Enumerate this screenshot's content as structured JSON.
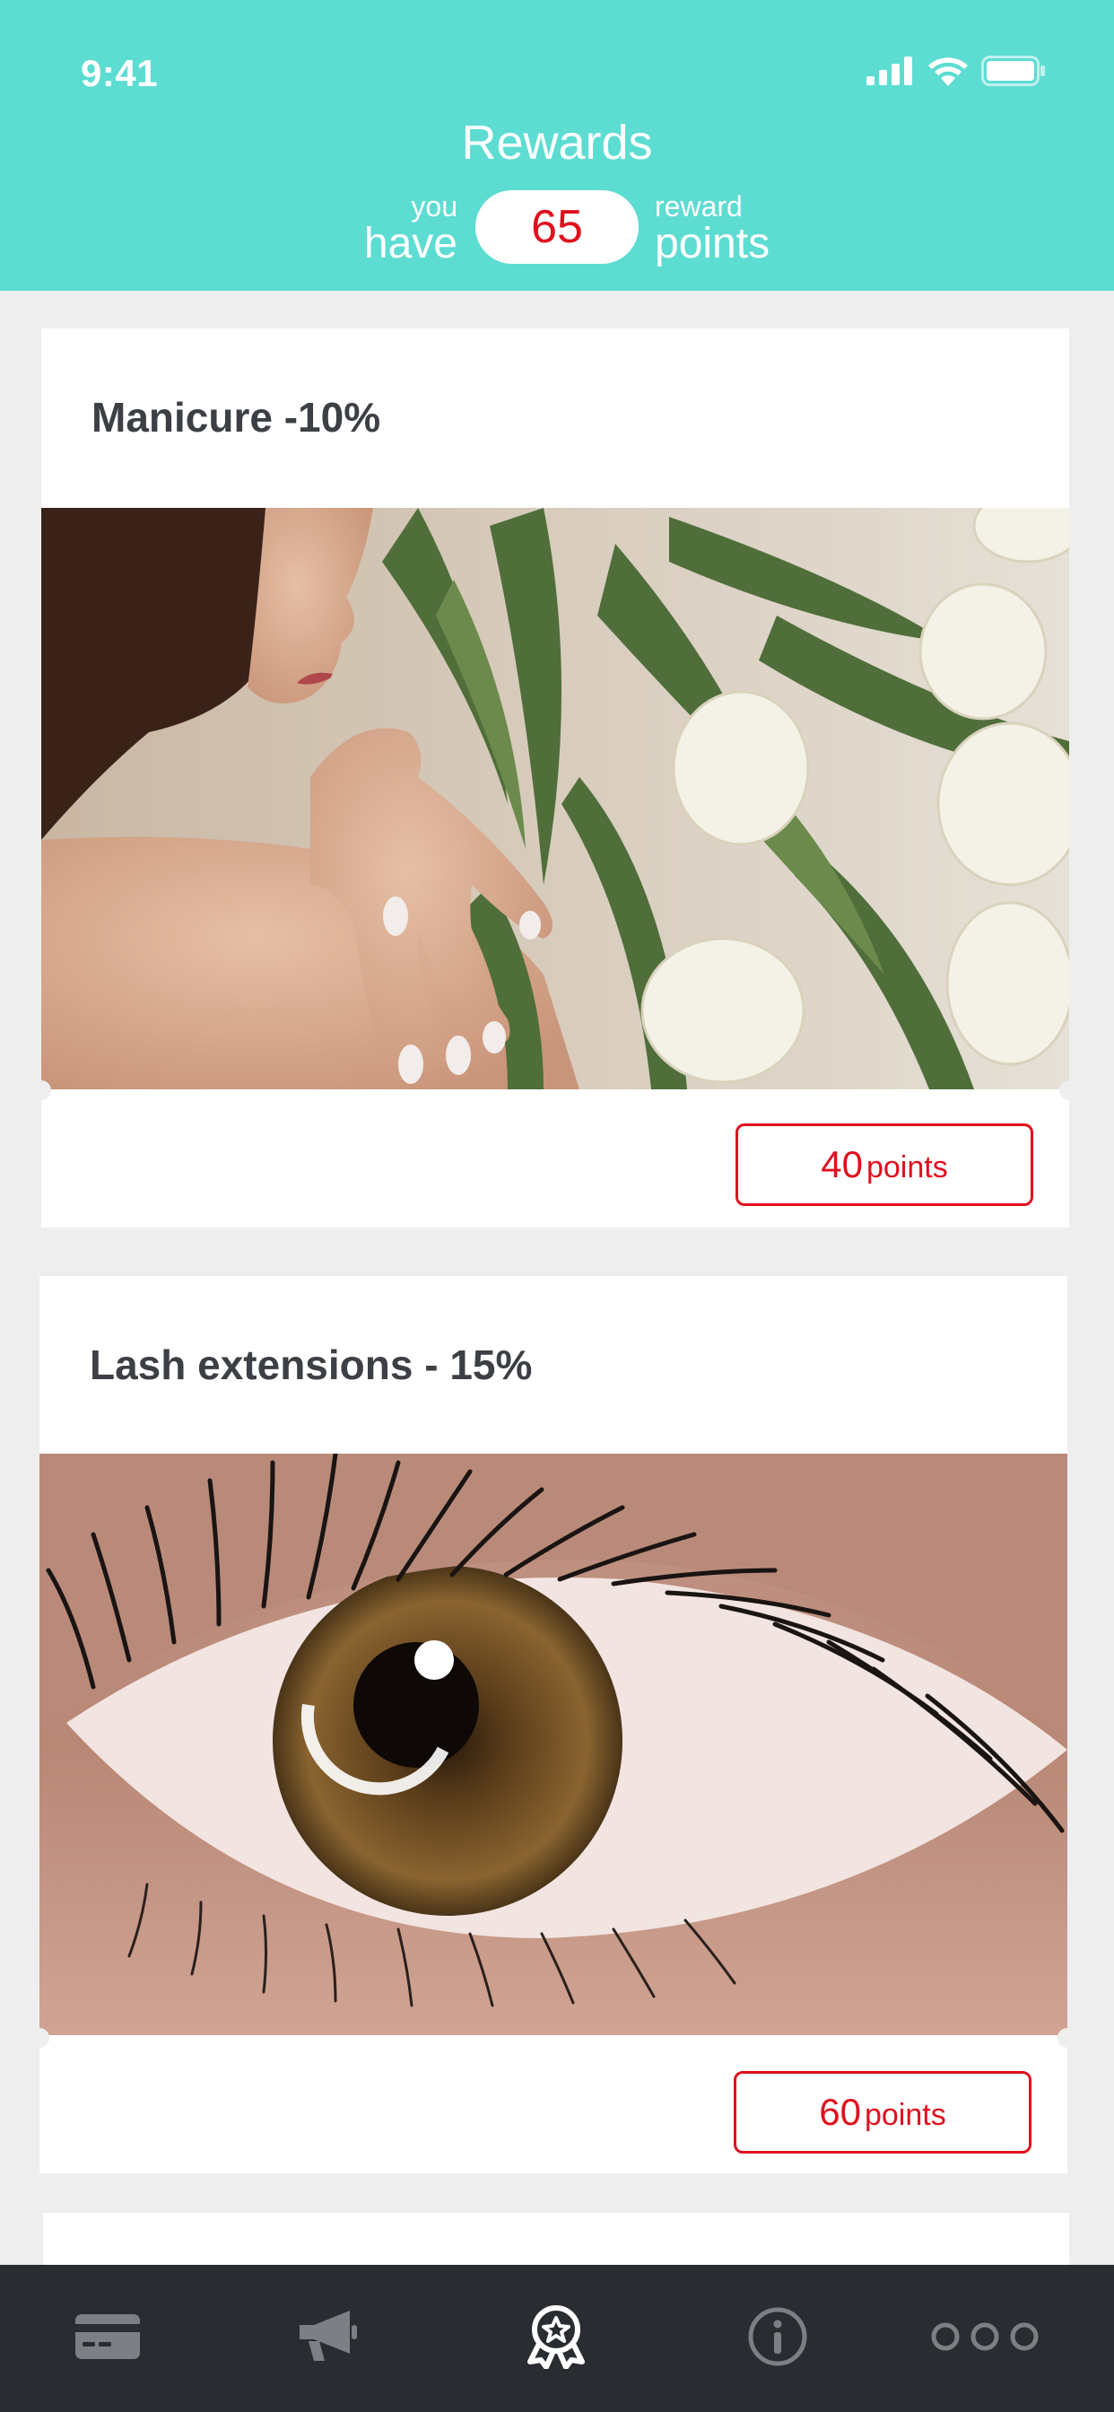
{
  "status_bar": {
    "time": "9:41",
    "icons": [
      "signal-icon",
      "wifi-icon",
      "battery-icon"
    ]
  },
  "header": {
    "title": "Rewards",
    "you_small": "you",
    "have_big": "have",
    "points_value": "65",
    "reward_small": "reward",
    "points_big": "points"
  },
  "rewards": [
    {
      "title": "Manicure -10%",
      "cost_value": "40",
      "cost_unit": "points",
      "image": "manicure-photo"
    },
    {
      "title": "Lash extensions - 15%",
      "cost_value": "60",
      "cost_unit": "points",
      "image": "lash-photo"
    }
  ],
  "tabbar": {
    "items": [
      {
        "icon": "card-icon",
        "active": false
      },
      {
        "icon": "megaphone-icon",
        "active": false
      },
      {
        "icon": "award-icon",
        "active": true
      },
      {
        "icon": "info-icon",
        "active": false
      },
      {
        "icon": "more-icon",
        "active": false
      }
    ]
  },
  "colors": {
    "header_bg": "#5ddcd2",
    "accent_red": "#e0101e",
    "page_bg": "#eeeeee",
    "tabbar_bg": "#292c30",
    "tab_inactive": "#7c7f84",
    "tab_active": "#ffffff"
  }
}
